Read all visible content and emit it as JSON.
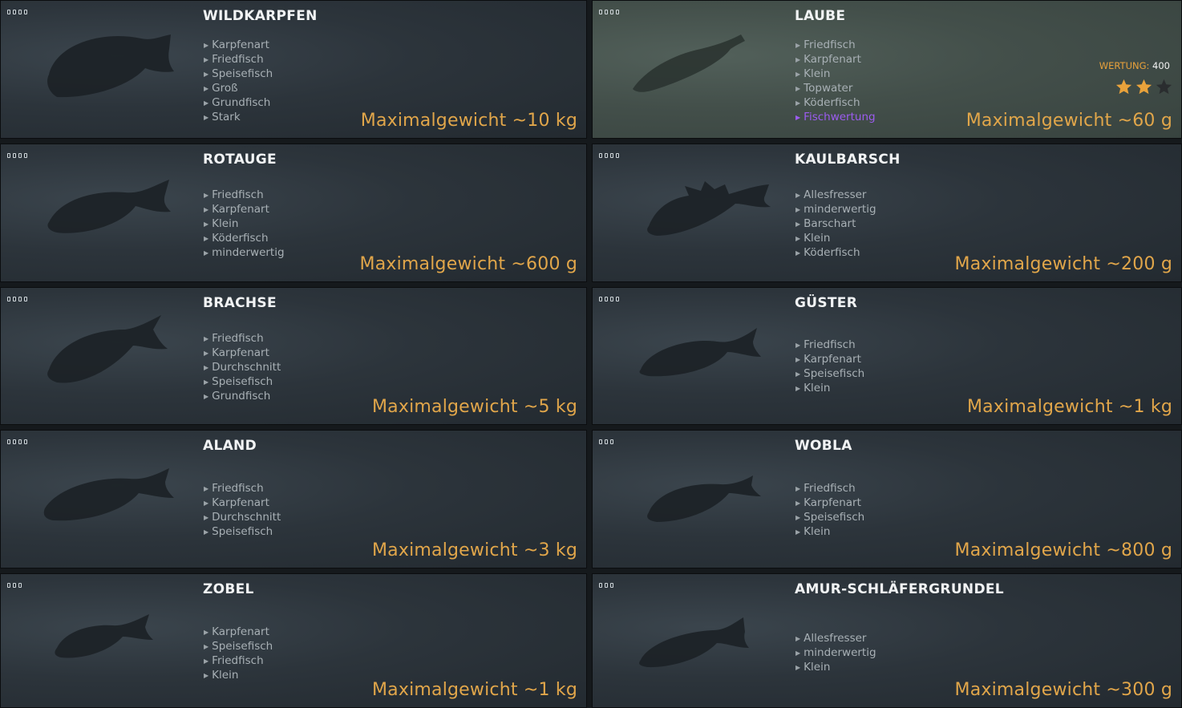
{
  "cards": [
    {
      "name": "WILDKARPFEN",
      "dots": 4,
      "tags": [
        "Karpfenart",
        "Friedfisch",
        "Speisefisch",
        "Groß",
        "Grundfisch",
        "Stark"
      ],
      "weight": "Maximalgewicht ~10 kg"
    },
    {
      "name": "LAUBE",
      "dots": 4,
      "tags": [
        "Friedfisch",
        "Karpfenart",
        "Klein",
        "Topwater",
        "Köderfisch"
      ],
      "special_tag": "Fischwertung",
      "weight": "Maximalgewicht ~60 g",
      "rating_label": "WERTUNG:",
      "rating_value": "400",
      "stars_filled": 2,
      "stars_total": 3
    },
    {
      "name": "ROTAUGE",
      "dots": 4,
      "tags": [
        "Friedfisch",
        "Karpfenart",
        "Klein",
        "Köderfisch",
        "minderwertig"
      ],
      "weight": "Maximalgewicht ~600 g"
    },
    {
      "name": "KAULBARSCH",
      "dots": 4,
      "tags": [
        "Allesfresser",
        "minderwertig",
        "Barschart",
        "Klein",
        "Köderfisch"
      ],
      "weight": "Maximalgewicht ~200 g"
    },
    {
      "name": "BRACHSE",
      "dots": 4,
      "tags": [
        "Friedfisch",
        "Karpfenart",
        "Durchschnitt",
        "Speisefisch",
        "Grundfisch"
      ],
      "weight": "Maximalgewicht ~5 kg"
    },
    {
      "name": "GÜSTER",
      "dots": 4,
      "tags": [
        "Friedfisch",
        "Karpfenart",
        "Speisefisch",
        "Klein"
      ],
      "weight": "Maximalgewicht ~1 kg"
    },
    {
      "name": "ALAND",
      "dots": 4,
      "tags": [
        "Friedfisch",
        "Karpfenart",
        "Durchschnitt",
        "Speisefisch"
      ],
      "weight": "Maximalgewicht ~3 kg"
    },
    {
      "name": "WOBLA",
      "dots": 3,
      "tags": [
        "Friedfisch",
        "Karpfenart",
        "Speisefisch",
        "Klein"
      ],
      "weight": "Maximalgewicht ~800 g"
    },
    {
      "name": "ZOBEL",
      "dots": 3,
      "tags": [
        "Karpfenart",
        "Speisefisch",
        "Friedfisch",
        "Klein"
      ],
      "weight": "Maximalgewicht ~1 kg"
    },
    {
      "name": "AMUR-SCHLÄFERGRUNDEL",
      "dots": 3,
      "tags": [
        "Allesfresser",
        "minderwertig",
        "Klein"
      ],
      "weight": "Maximalgewicht ~300 g"
    }
  ],
  "colors": {
    "weight": "#e1a64a",
    "tag": "#a8b0b5",
    "special_tag": "#9c5cf0",
    "title": "#f1f3f4",
    "star_filled": "#e9a23b",
    "star_empty": "#2a2d2f"
  }
}
